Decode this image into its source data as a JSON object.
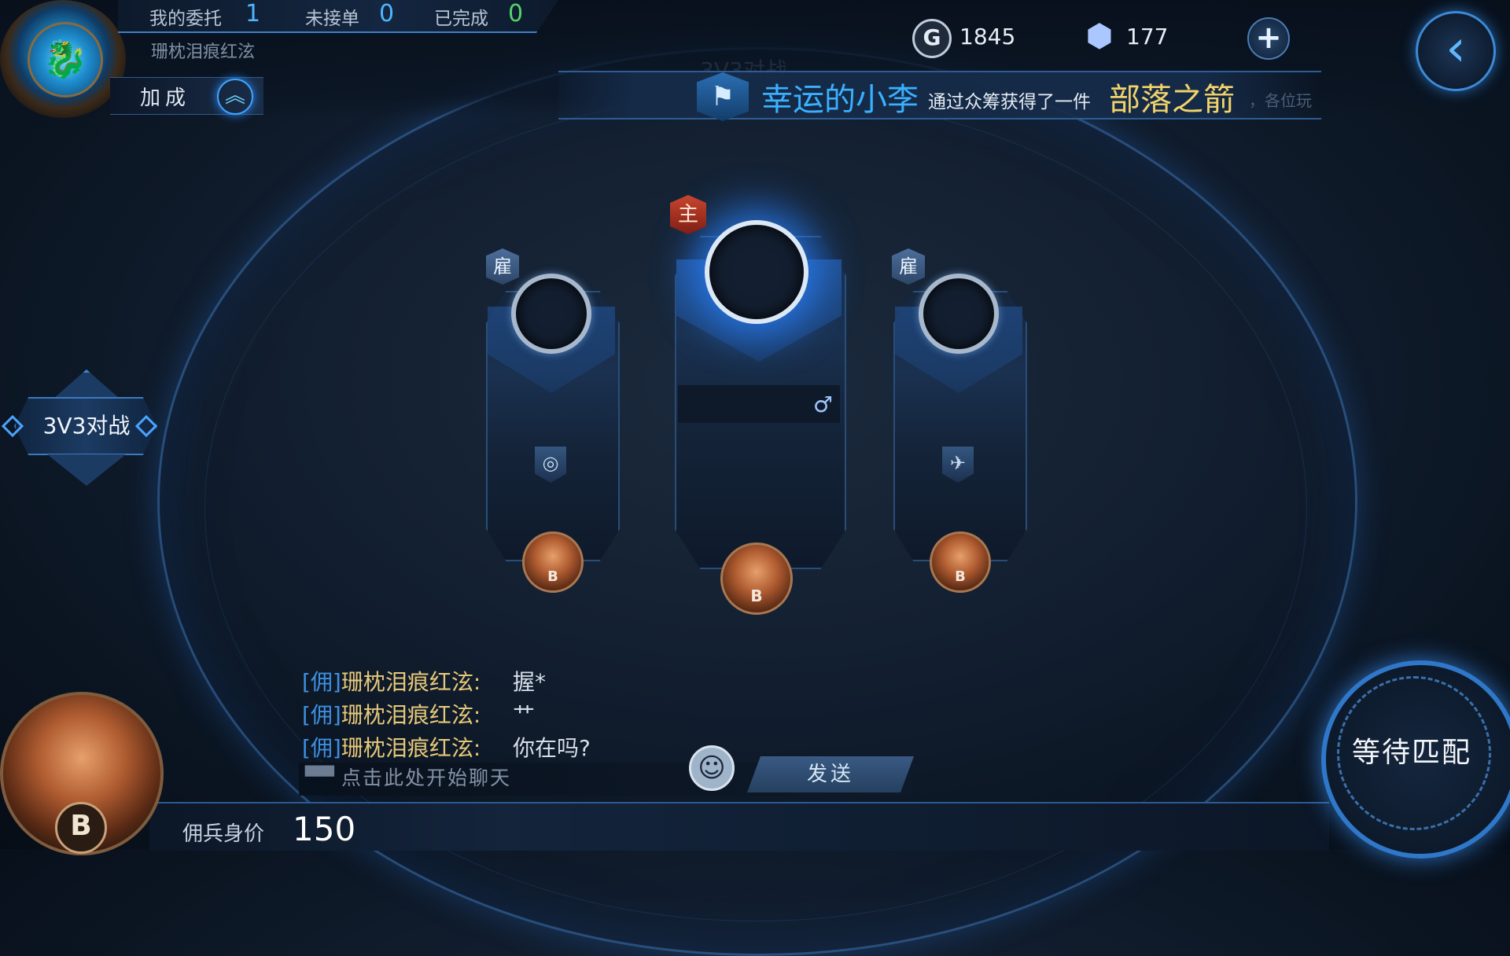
{
  "header": {
    "stats": [
      {
        "label": "我的委托",
        "value": "1"
      },
      {
        "label": "未接单",
        "value": "0"
      },
      {
        "label": "已完成",
        "value": "0"
      }
    ],
    "username": "珊枕泪痕红泫",
    "bonus_label": "加成",
    "bonus_icon": "chevron-up-icon"
  },
  "currency": {
    "gold_symbol": "G",
    "gold": "1845",
    "gems": "177",
    "add_symbol": "+",
    "back_symbol": "‹"
  },
  "announcement": {
    "title_ghost": "3V3对战",
    "player": "幸运的小李",
    "middle": "通过众筹获得了一件",
    "item": "部落之箭",
    "tail": "，各位玩"
  },
  "mode": {
    "label": "3V3对战"
  },
  "slots": {
    "left": {
      "badge": "雇",
      "role_icon": "eye-icon",
      "medal": "B"
    },
    "center": {
      "badge": "主",
      "gender": "♂",
      "medal": "B"
    },
    "right": {
      "badge": "雇",
      "role_icon": "bird-icon",
      "medal": "B"
    }
  },
  "chat": {
    "lines": [
      {
        "tag": "[佣]",
        "name": "珊枕泪痕红泫:",
        "msg": "握*"
      },
      {
        "tag": "[佣]",
        "name": "珊枕泪痕红泫:",
        "msg": "艹"
      },
      {
        "tag": "[佣]",
        "name": "珊枕泪痕红泫:",
        "msg": "你在吗?"
      }
    ],
    "placeholder": "点击此处开始聊天",
    "send_label": "发送"
  },
  "footer": {
    "value_label": "佣兵身价",
    "value": "150",
    "rank_letter": "B",
    "match_label": "等待匹配"
  }
}
